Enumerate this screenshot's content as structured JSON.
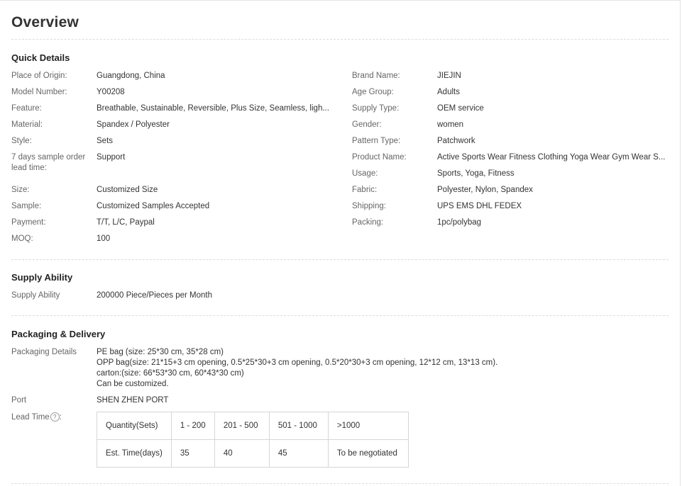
{
  "overview": {
    "title": "Overview"
  },
  "quick_details": {
    "title": "Quick Details",
    "left": [
      {
        "label": "Place of Origin:",
        "value": "Guangdong, China"
      },
      {
        "label": "Model Number:",
        "value": "Y00208"
      },
      {
        "label": "Feature:",
        "value": "Breathable, Sustainable, Reversible, Plus Size, Seamless, ligh..."
      },
      {
        "label": "Material:",
        "value": "Spandex / Polyester"
      },
      {
        "label": "Style:",
        "value": "Sets"
      },
      {
        "label": "7 days sample order lead time:",
        "value": "Support"
      },
      {
        "label": "Size:",
        "value": "Customized Size"
      },
      {
        "label": "Sample:",
        "value": "Customized Samples Accepted"
      },
      {
        "label": "Payment:",
        "value": "T/T, L/C, Paypal"
      },
      {
        "label": "MOQ:",
        "value": "100"
      }
    ],
    "right": [
      {
        "label": "Brand Name:",
        "value": "JIEJIN"
      },
      {
        "label": "Age Group:",
        "value": "Adults"
      },
      {
        "label": "Supply Type:",
        "value": "OEM service"
      },
      {
        "label": "Gender:",
        "value": "women"
      },
      {
        "label": "Pattern Type:",
        "value": "Patchwork"
      },
      {
        "label": "Product Name:",
        "value": "Active Sports Wear Fitness Clothing Yoga Wear Gym Wear S..."
      },
      {
        "label": "Usage:",
        "value": "Sports, Yoga, Fitness"
      },
      {
        "label": "Fabric:",
        "value": "Polyester, Nylon, Spandex"
      },
      {
        "label": "Shipping:",
        "value": "UPS EMS DHL FEDEX"
      },
      {
        "label": "Packing:",
        "value": "1pc/polybag"
      }
    ]
  },
  "supply_ability": {
    "title": "Supply Ability",
    "label": "Supply Ability",
    "value": "200000 Piece/Pieces per Month"
  },
  "packaging_delivery": {
    "title": "Packaging & Delivery",
    "packaging_label": "Packaging Details",
    "packaging_lines": [
      "PE bag (size: 25*30 cm, 35*28 cm)",
      "OPP bag(size: 21*15+3 cm opening, 0.5*25*30+3 cm opening, 0.5*20*30+3 cm opening, 12*12 cm, 13*13 cm).",
      "carton:(size: 66*53*30 cm, 60*43*30 cm)",
      "Can be customized."
    ],
    "port_label": "Port",
    "port_value": "SHEN ZHEN PORT",
    "lead_time_label": "Lead Time",
    "lead_time_suffix": ":",
    "help_icon": "question-circle-icon",
    "help_glyph": "?",
    "lead_table": {
      "row1": [
        "Quantity(Sets)",
        "1 - 200",
        "201 - 500",
        "501 - 1000",
        ">1000"
      ],
      "row2": [
        "Est. Time(days)",
        "35",
        "40",
        "45",
        "To be negotiated"
      ]
    }
  }
}
